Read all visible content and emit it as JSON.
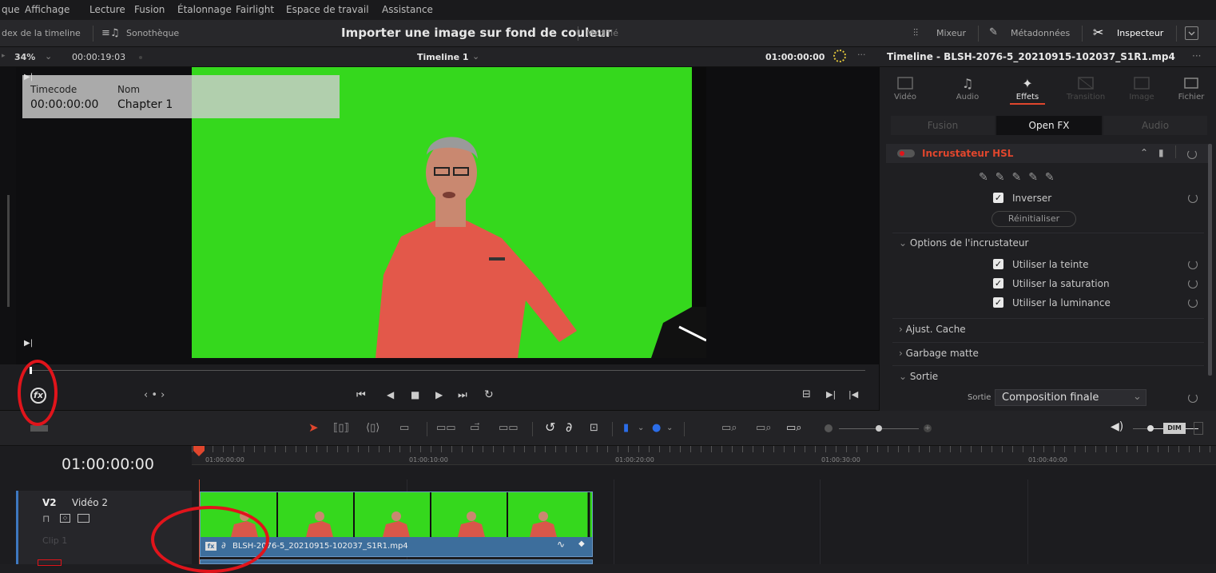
{
  "menu": {
    "items": [
      "que",
      "Affichage",
      "Lecture",
      "Fusion",
      "Étalonnage",
      "Fairlight",
      "Espace de travail",
      "Assistance"
    ]
  },
  "toolbar": {
    "index_label": "dex de la timeline",
    "sound_library_label": "Sonothèque",
    "project_title": "Importer une image sur fond de couleur",
    "modified_label": "Modifié",
    "mixer_label": "Mixeur",
    "metadata_label": "Métadonnées",
    "inspector_label": "Inspecteur"
  },
  "viewer": {
    "zoom": "34%",
    "duration": "00:00:19:03",
    "timeline_name": "Timeline 1",
    "timecode": "01:00:00:00",
    "overlay": {
      "timecode_header": "Timecode",
      "name_header": "Nom",
      "timecode_value": "00:00:00:00",
      "name_value": "Chapter 1"
    },
    "nav_label": "‹ • ›"
  },
  "inspector": {
    "title": "Timeline - BLSH-2076-5_20210915-102037_S1R1.mp4",
    "tabs": [
      "Vidéo",
      "Audio",
      "Effets",
      "Transition",
      "Image",
      "Fichier"
    ],
    "active_tab": "Effets",
    "subtabs": [
      "Fusion",
      "Open FX",
      "Audio"
    ],
    "active_subtab": "Open FX",
    "effect_name": "Incrustateur HSL",
    "invert_label": "Inverser",
    "reset_button": "Réinitialiser",
    "keyer_options_label": "Options de l'incrustateur",
    "options": [
      "Utiliser la teinte",
      "Utiliser la saturation",
      "Utiliser la luminance"
    ],
    "ajust_cache": "Ajust. Cache",
    "garbage_matte": "Garbage matte",
    "sortie_section": "Sortie",
    "sortie_label": "Sortie",
    "sortie_value": "Composition finale"
  },
  "timeline": {
    "current_timecode": "01:00:00:00",
    "ruler_ticks": [
      "01:00:00:00",
      "01:00:10:00",
      "01:00:20:00",
      "01:00:30:00",
      "01:00:40:00"
    ],
    "dim_label": "DIM",
    "track": {
      "id": "V2",
      "name": "Vidéo 2",
      "clip_count": "Clip 1"
    },
    "clip_name": "BLSH-2076-5_20210915-102037_S1R1.mp4"
  },
  "colors": {
    "accent_red": "#e0141b",
    "effects_tab_underline": "#e0462d",
    "green_screen": "#35d81d",
    "clip_blue": "#3d6e9c"
  }
}
